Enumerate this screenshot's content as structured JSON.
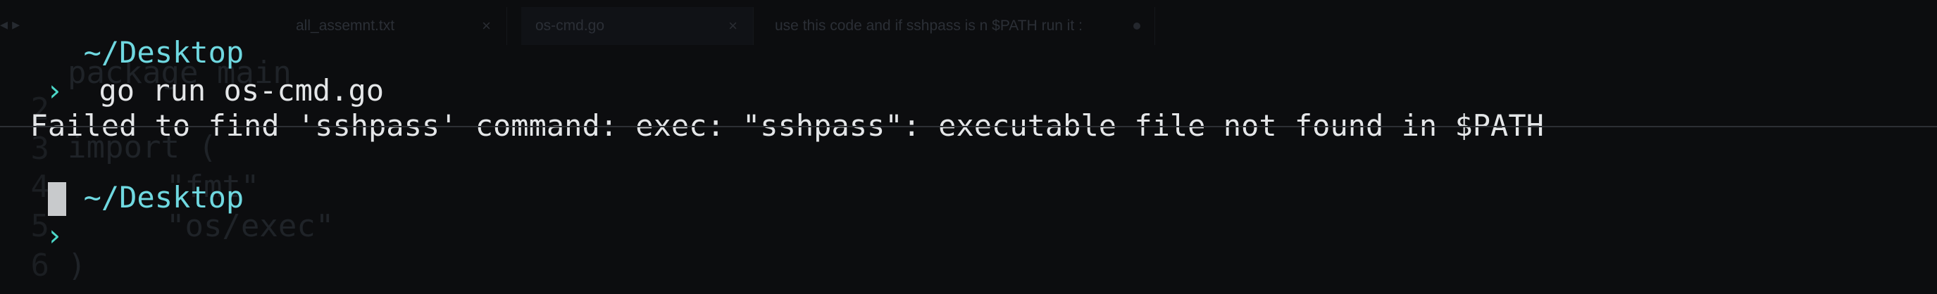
{
  "background_editor": {
    "nav_arrows": "◂ ▸",
    "tabs": [
      {
        "label": "all_assemnt.txt",
        "close": "×"
      },
      {
        "label": "os-cmd.go",
        "close": "×"
      },
      {
        "label": "use this code and if sshpass is n $PATH run it :",
        "close": ""
      }
    ],
    "lines": [
      {
        "num": "2",
        "text": "package main"
      },
      {
        "num": "3",
        "text": "import ("
      },
      {
        "num": "4",
        "text": "    \"fmt\""
      },
      {
        "num": "5",
        "text": "    \"os/exec\""
      },
      {
        "num": "6",
        "text": ")"
      }
    ]
  },
  "terminal": {
    "prompt_path_1": "~/Desktop",
    "prompt_arrow": "›",
    "command": "go run os-cmd.go",
    "error_output": "Failed to find 'sshpass' command: exec: \"sshpass\": executable file not found in $PATH",
    "prompt_path_2": "~/Desktop"
  },
  "colors": {
    "background": "#0c0d0f",
    "prompt_path": "#6fd8e0",
    "prompt_arrow": "#4cd7c8",
    "text": "#e4e6e8",
    "cursor": "#c8cacc"
  }
}
